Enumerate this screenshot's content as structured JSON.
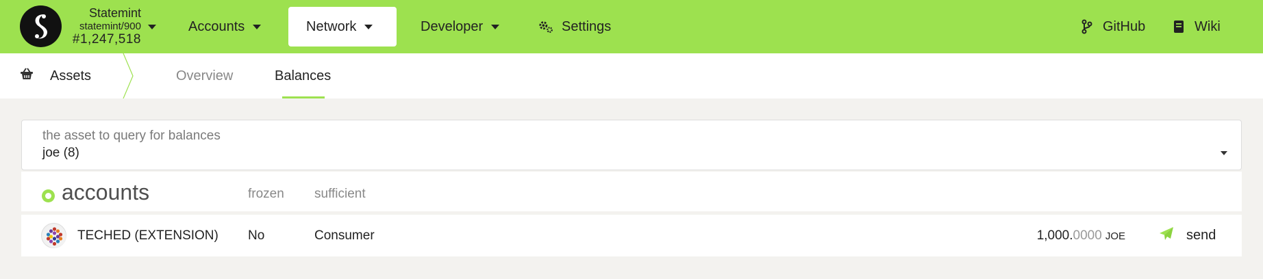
{
  "header": {
    "chain": {
      "name": "Statemint",
      "id": "statemint/900",
      "block": "#1,247,518"
    },
    "nav": [
      {
        "key": "accounts",
        "label": "Accounts"
      },
      {
        "key": "network",
        "label": "Network",
        "active": true
      },
      {
        "key": "developer",
        "label": "Developer"
      },
      {
        "key": "settings",
        "label": "Settings",
        "icon": "gears-icon"
      }
    ],
    "links": [
      {
        "key": "github",
        "label": "GitHub",
        "icon": "code-branch-icon"
      },
      {
        "key": "wiki",
        "label": "Wiki",
        "icon": "book-icon"
      }
    ],
    "accent_color": "#9de14f"
  },
  "subnav": {
    "section": {
      "label": "Assets",
      "icon": "basket-icon"
    },
    "tabs": [
      {
        "label": "Overview",
        "active": false
      },
      {
        "label": "Balances",
        "active": true
      }
    ]
  },
  "asset_selector": {
    "label": "the asset to query for balances",
    "value": "joe (8)"
  },
  "table": {
    "title": "accounts",
    "columns": [
      "frozen",
      "sufficient"
    ],
    "rows": [
      {
        "account": "TECHED (EXTENSION)",
        "frozen": "No",
        "sufficient": "Consumer",
        "balance_int": "1,000.",
        "balance_dec": "0000",
        "balance_unit": "JOE",
        "action": "send"
      }
    ]
  }
}
